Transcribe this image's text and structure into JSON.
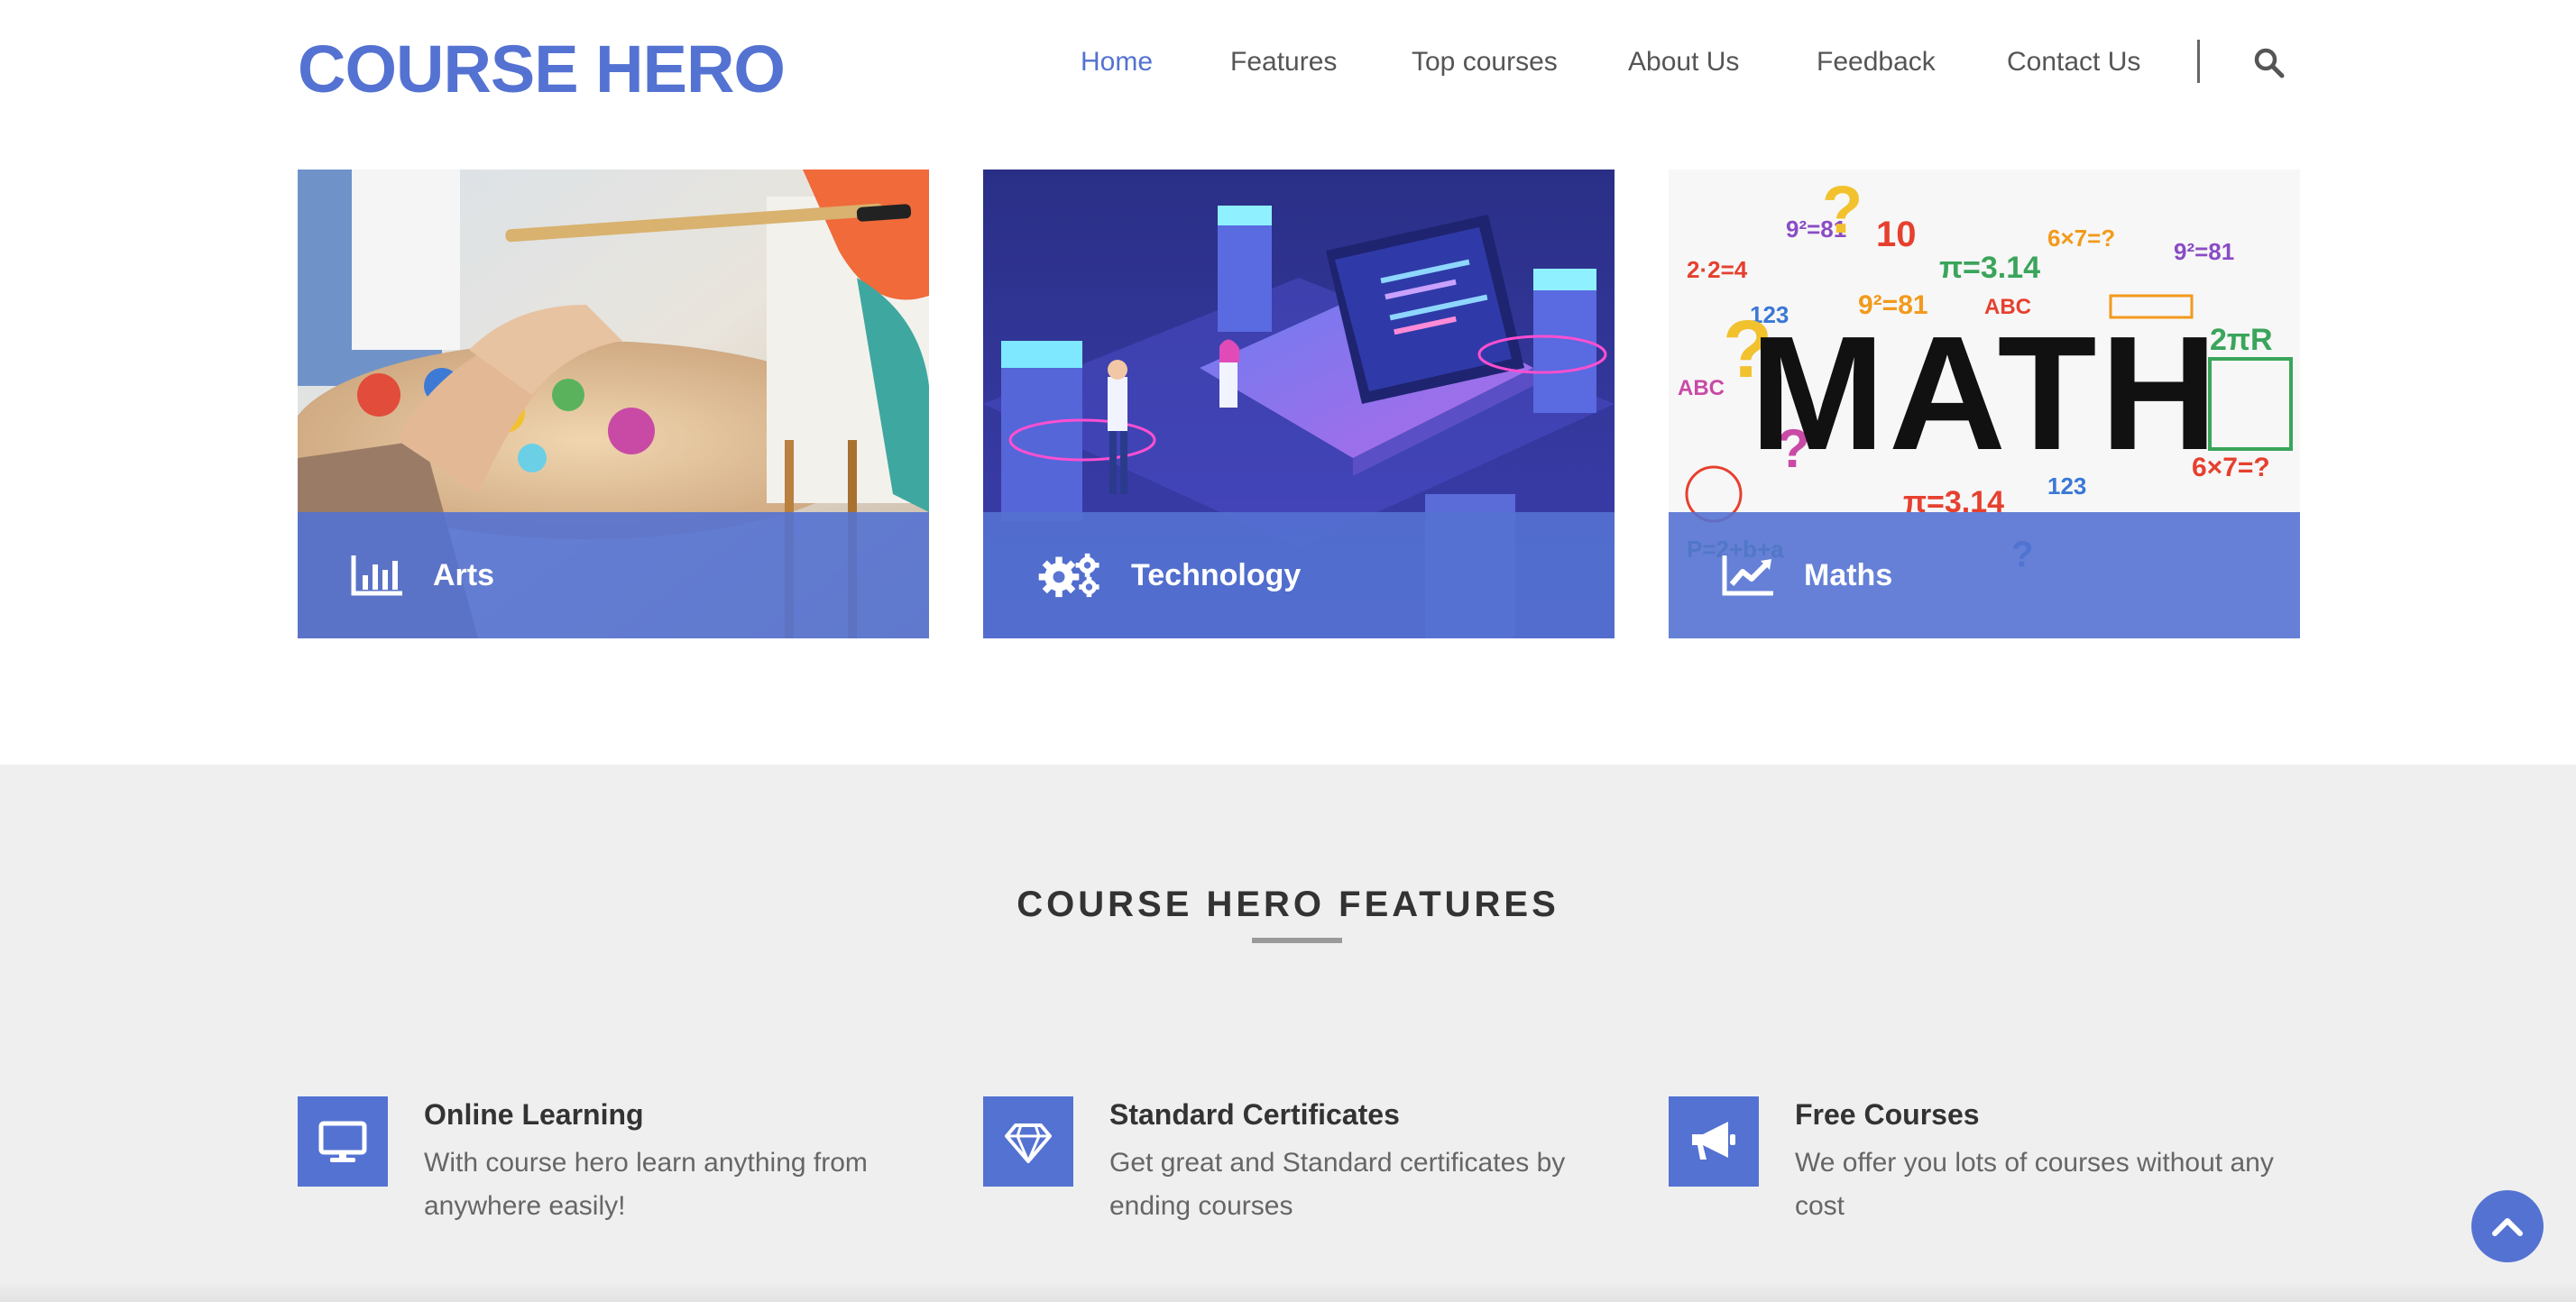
{
  "header": {
    "logo": "COURSE HERO",
    "nav": [
      "Home",
      "Features",
      "Top courses",
      "About Us",
      "Feedback",
      "Contact Us"
    ],
    "active_nav": "Home",
    "search_icon": "search-icon"
  },
  "courses": [
    {
      "label": "Arts",
      "icon": "bar-chart-icon"
    },
    {
      "label": "Technology",
      "icon": "gears-icon"
    },
    {
      "label": "Maths",
      "icon": "line-chart-icon"
    }
  ],
  "features": {
    "title": "COURSE HERO FEATURES",
    "items": [
      {
        "heading": "Online Learning",
        "text": "With course hero learn anything from anywhere easily!",
        "icon": "monitor-icon"
      },
      {
        "heading": "Standard Certificates",
        "text": "Get great and Standard certificates by ending courses",
        "icon": "diamond-icon"
      },
      {
        "heading": "Free Courses",
        "text": "We offer you lots of courses without any cost",
        "icon": "megaphone-icon"
      }
    ]
  },
  "colors": {
    "accent": "#5472d2",
    "section_bg": "#efefef",
    "text_dark": "#333333",
    "text_muted": "#666666"
  },
  "back_to_top_icon": "chevron-up-icon"
}
